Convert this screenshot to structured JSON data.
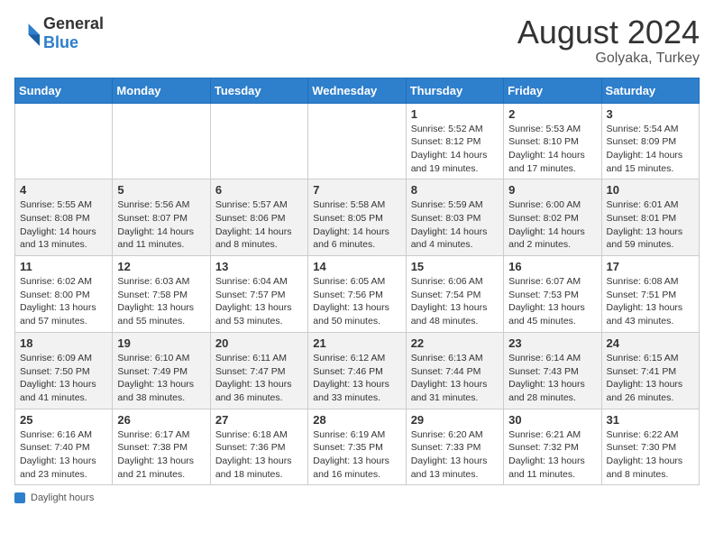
{
  "header": {
    "logo": {
      "general": "General",
      "blue": "Blue"
    },
    "title": "August 2024",
    "subtitle": "Golyaka, Turkey"
  },
  "weekdays": [
    "Sunday",
    "Monday",
    "Tuesday",
    "Wednesday",
    "Thursday",
    "Friday",
    "Saturday"
  ],
  "weeks": [
    [
      {
        "day": "",
        "info": ""
      },
      {
        "day": "",
        "info": ""
      },
      {
        "day": "",
        "info": ""
      },
      {
        "day": "",
        "info": ""
      },
      {
        "day": "1",
        "info": "Sunrise: 5:52 AM\nSunset: 8:12 PM\nDaylight: 14 hours\nand 19 minutes."
      },
      {
        "day": "2",
        "info": "Sunrise: 5:53 AM\nSunset: 8:10 PM\nDaylight: 14 hours\nand 17 minutes."
      },
      {
        "day": "3",
        "info": "Sunrise: 5:54 AM\nSunset: 8:09 PM\nDaylight: 14 hours\nand 15 minutes."
      }
    ],
    [
      {
        "day": "4",
        "info": "Sunrise: 5:55 AM\nSunset: 8:08 PM\nDaylight: 14 hours\nand 13 minutes."
      },
      {
        "day": "5",
        "info": "Sunrise: 5:56 AM\nSunset: 8:07 PM\nDaylight: 14 hours\nand 11 minutes."
      },
      {
        "day": "6",
        "info": "Sunrise: 5:57 AM\nSunset: 8:06 PM\nDaylight: 14 hours\nand 8 minutes."
      },
      {
        "day": "7",
        "info": "Sunrise: 5:58 AM\nSunset: 8:05 PM\nDaylight: 14 hours\nand 6 minutes."
      },
      {
        "day": "8",
        "info": "Sunrise: 5:59 AM\nSunset: 8:03 PM\nDaylight: 14 hours\nand 4 minutes."
      },
      {
        "day": "9",
        "info": "Sunrise: 6:00 AM\nSunset: 8:02 PM\nDaylight: 14 hours\nand 2 minutes."
      },
      {
        "day": "10",
        "info": "Sunrise: 6:01 AM\nSunset: 8:01 PM\nDaylight: 13 hours\nand 59 minutes."
      }
    ],
    [
      {
        "day": "11",
        "info": "Sunrise: 6:02 AM\nSunset: 8:00 PM\nDaylight: 13 hours\nand 57 minutes."
      },
      {
        "day": "12",
        "info": "Sunrise: 6:03 AM\nSunset: 7:58 PM\nDaylight: 13 hours\nand 55 minutes."
      },
      {
        "day": "13",
        "info": "Sunrise: 6:04 AM\nSunset: 7:57 PM\nDaylight: 13 hours\nand 53 minutes."
      },
      {
        "day": "14",
        "info": "Sunrise: 6:05 AM\nSunset: 7:56 PM\nDaylight: 13 hours\nand 50 minutes."
      },
      {
        "day": "15",
        "info": "Sunrise: 6:06 AM\nSunset: 7:54 PM\nDaylight: 13 hours\nand 48 minutes."
      },
      {
        "day": "16",
        "info": "Sunrise: 6:07 AM\nSunset: 7:53 PM\nDaylight: 13 hours\nand 45 minutes."
      },
      {
        "day": "17",
        "info": "Sunrise: 6:08 AM\nSunset: 7:51 PM\nDaylight: 13 hours\nand 43 minutes."
      }
    ],
    [
      {
        "day": "18",
        "info": "Sunrise: 6:09 AM\nSunset: 7:50 PM\nDaylight: 13 hours\nand 41 minutes."
      },
      {
        "day": "19",
        "info": "Sunrise: 6:10 AM\nSunset: 7:49 PM\nDaylight: 13 hours\nand 38 minutes."
      },
      {
        "day": "20",
        "info": "Sunrise: 6:11 AM\nSunset: 7:47 PM\nDaylight: 13 hours\nand 36 minutes."
      },
      {
        "day": "21",
        "info": "Sunrise: 6:12 AM\nSunset: 7:46 PM\nDaylight: 13 hours\nand 33 minutes."
      },
      {
        "day": "22",
        "info": "Sunrise: 6:13 AM\nSunset: 7:44 PM\nDaylight: 13 hours\nand 31 minutes."
      },
      {
        "day": "23",
        "info": "Sunrise: 6:14 AM\nSunset: 7:43 PM\nDaylight: 13 hours\nand 28 minutes."
      },
      {
        "day": "24",
        "info": "Sunrise: 6:15 AM\nSunset: 7:41 PM\nDaylight: 13 hours\nand 26 minutes."
      }
    ],
    [
      {
        "day": "25",
        "info": "Sunrise: 6:16 AM\nSunset: 7:40 PM\nDaylight: 13 hours\nand 23 minutes."
      },
      {
        "day": "26",
        "info": "Sunrise: 6:17 AM\nSunset: 7:38 PM\nDaylight: 13 hours\nand 21 minutes."
      },
      {
        "day": "27",
        "info": "Sunrise: 6:18 AM\nSunset: 7:36 PM\nDaylight: 13 hours\nand 18 minutes."
      },
      {
        "day": "28",
        "info": "Sunrise: 6:19 AM\nSunset: 7:35 PM\nDaylight: 13 hours\nand 16 minutes."
      },
      {
        "day": "29",
        "info": "Sunrise: 6:20 AM\nSunset: 7:33 PM\nDaylight: 13 hours\nand 13 minutes."
      },
      {
        "day": "30",
        "info": "Sunrise: 6:21 AM\nSunset: 7:32 PM\nDaylight: 13 hours\nand 11 minutes."
      },
      {
        "day": "31",
        "info": "Sunrise: 6:22 AM\nSunset: 7:30 PM\nDaylight: 13 hours\nand 8 minutes."
      }
    ]
  ],
  "footer": {
    "label": "Daylight hours"
  }
}
